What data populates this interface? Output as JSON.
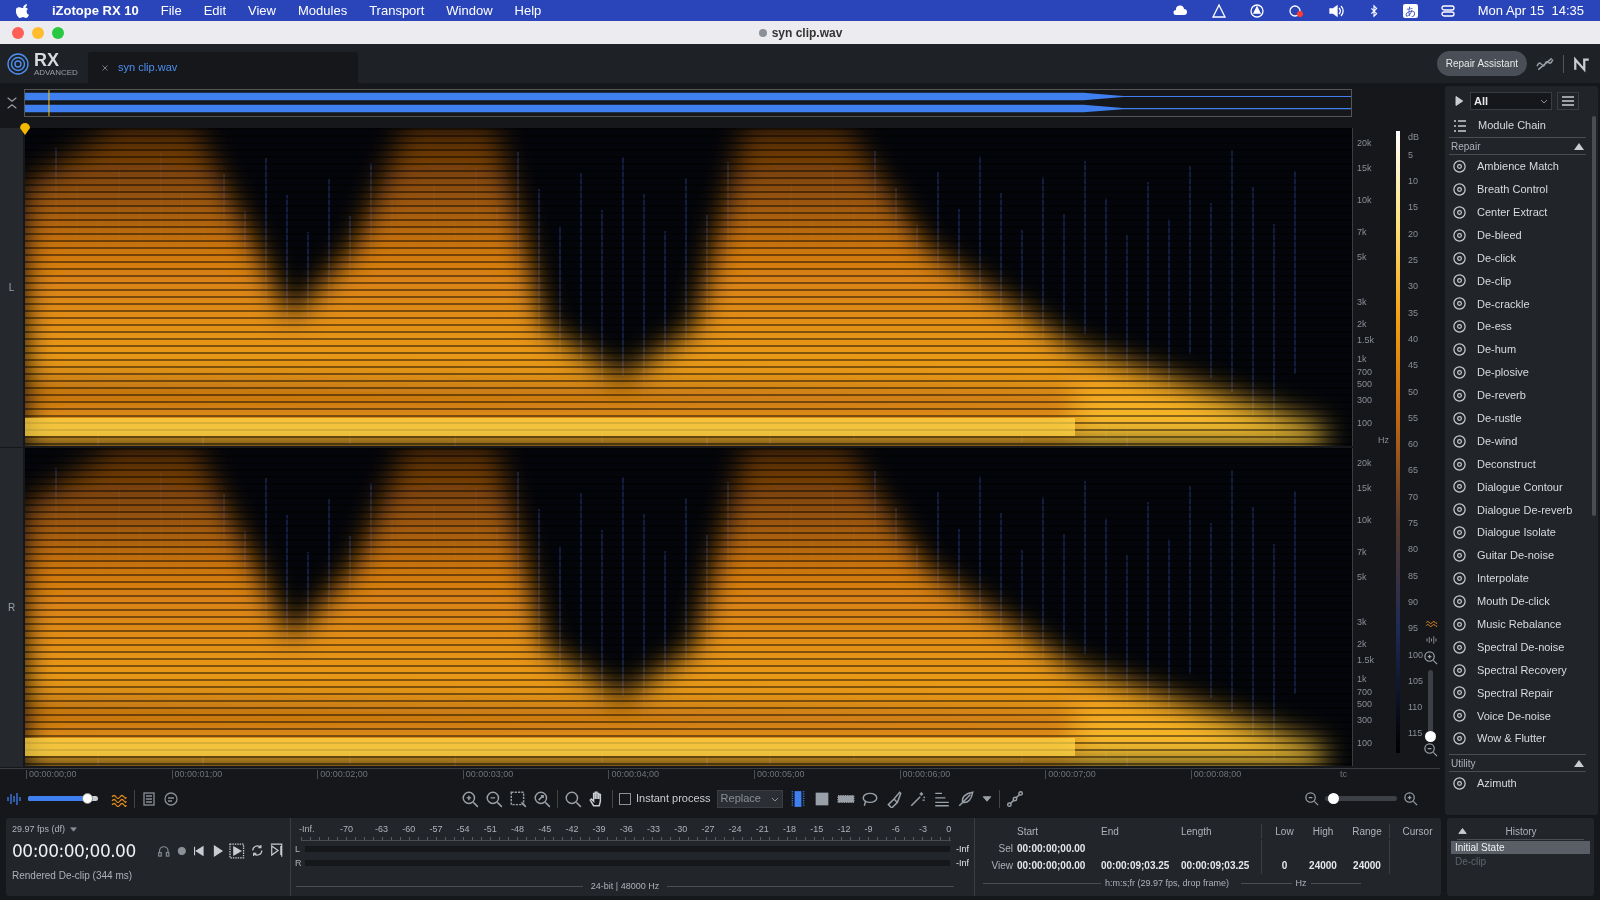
{
  "menubar": {
    "app_name": "iZotope RX 10",
    "items": [
      "File",
      "Edit",
      "View",
      "Modules",
      "Transport",
      "Window",
      "Help"
    ],
    "input_method": "あ",
    "clock": "Mon Apr 15  14:35"
  },
  "window": {
    "title": "syn clip.wav"
  },
  "header": {
    "logo_text": "RX",
    "logo_subtext": "ADVANCED",
    "tab_label": "syn clip.wav",
    "repair_assistant": "Repair Assistant"
  },
  "spectrogram": {
    "channels": [
      {
        "label": "L",
        "freq_ticks": [
          "20k",
          "15k",
          "10k",
          "7k",
          "5k",
          "3k",
          "2k",
          "1.5k",
          "1k",
          "700",
          "500",
          "300",
          "100"
        ],
        "unit": "Hz"
      },
      {
        "label": "R",
        "freq_ticks": [
          "20k",
          "15k",
          "10k",
          "7k",
          "5k",
          "3k",
          "2k",
          "1.5k",
          "1k",
          "700",
          "500",
          "300",
          "100"
        ]
      }
    ],
    "db_unit": "dB",
    "db_ticks": [
      "5",
      "10",
      "15",
      "20",
      "25",
      "30",
      "35",
      "40",
      "45",
      "50",
      "55",
      "60",
      "65",
      "70",
      "75",
      "80",
      "85",
      "90",
      "95",
      "100",
      "105",
      "110",
      "115"
    ],
    "time_ticks": [
      "00:00:00;00",
      "00:00:01;00",
      "00:00:02;00",
      "00:00:03;00",
      "00:00:04;00",
      "00:00:05;00",
      "00:00:06;00",
      "00:00:07;00",
      "00:00:08;00"
    ],
    "time_unit": "tc",
    "vertical_zoom": {
      "level": 0
    }
  },
  "toolbar": {
    "blend": {
      "level": 0.92
    },
    "instant_process": {
      "label": "Instant process",
      "checked": false
    },
    "mode": "Replace",
    "horizontal_zoom": {
      "level": 0.05
    }
  },
  "sidebar": {
    "filter": "All",
    "module_chain": "Module Chain",
    "sections": [
      {
        "title": "Repair",
        "expanded": true,
        "modules": [
          "Ambience Match",
          "Breath Control",
          "Center Extract",
          "De-bleed",
          "De-click",
          "De-clip",
          "De-crackle",
          "De-ess",
          "De-hum",
          "De-plosive",
          "De-reverb",
          "De-rustle",
          "De-wind",
          "Deconstruct",
          "Dialogue Contour",
          "Dialogue De-reverb",
          "Dialogue Isolate",
          "Guitar De-noise",
          "Interpolate",
          "Mouth De-click",
          "Music Rebalance",
          "Spectral De-noise",
          "Spectral Recovery",
          "Spectral Repair",
          "Voice De-noise",
          "Wow & Flutter"
        ]
      },
      {
        "title": "Utility",
        "expanded": true,
        "modules": [
          "Azimuth"
        ]
      }
    ]
  },
  "transport": {
    "fps": "29.97 fps (df)",
    "timecode": "00:00:00;00.00",
    "status": "Rendered De-clip (344 ms)"
  },
  "meter": {
    "scale": [
      "-Inf.",
      "-70",
      "-63",
      "-60",
      "-57",
      "-54",
      "-51",
      "-48",
      "-45",
      "-42",
      "-39",
      "-36",
      "-33",
      "-30",
      "-27",
      "-24",
      "-21",
      "-18",
      "-15",
      "-12",
      "-9",
      "-6",
      "-3",
      "0"
    ],
    "channels": [
      {
        "label": "L",
        "peak": "-Inf"
      },
      {
        "label": "R",
        "peak": "-Inf"
      }
    ],
    "format": "24-bit | 48000 Hz"
  },
  "selection": {
    "headers": [
      "Start",
      "End",
      "Length",
      "Low",
      "High",
      "Range",
      "Cursor"
    ],
    "rows": [
      {
        "label": "Sel",
        "start": "00:00:00;00.00"
      },
      {
        "label": "View",
        "start": "00:00:00;00.00",
        "end": "00:00:09;03.25",
        "length": "00:00:09;03.25",
        "low": "0",
        "high": "24000",
        "range": "24000"
      }
    ],
    "time_format": "h:m:s;fr (29.97 fps, drop frame)",
    "freq_unit": "Hz"
  },
  "history": {
    "title": "History",
    "items": [
      {
        "label": "Initial State",
        "selected": true
      },
      {
        "label": "De-clip",
        "selected": false
      }
    ]
  }
}
